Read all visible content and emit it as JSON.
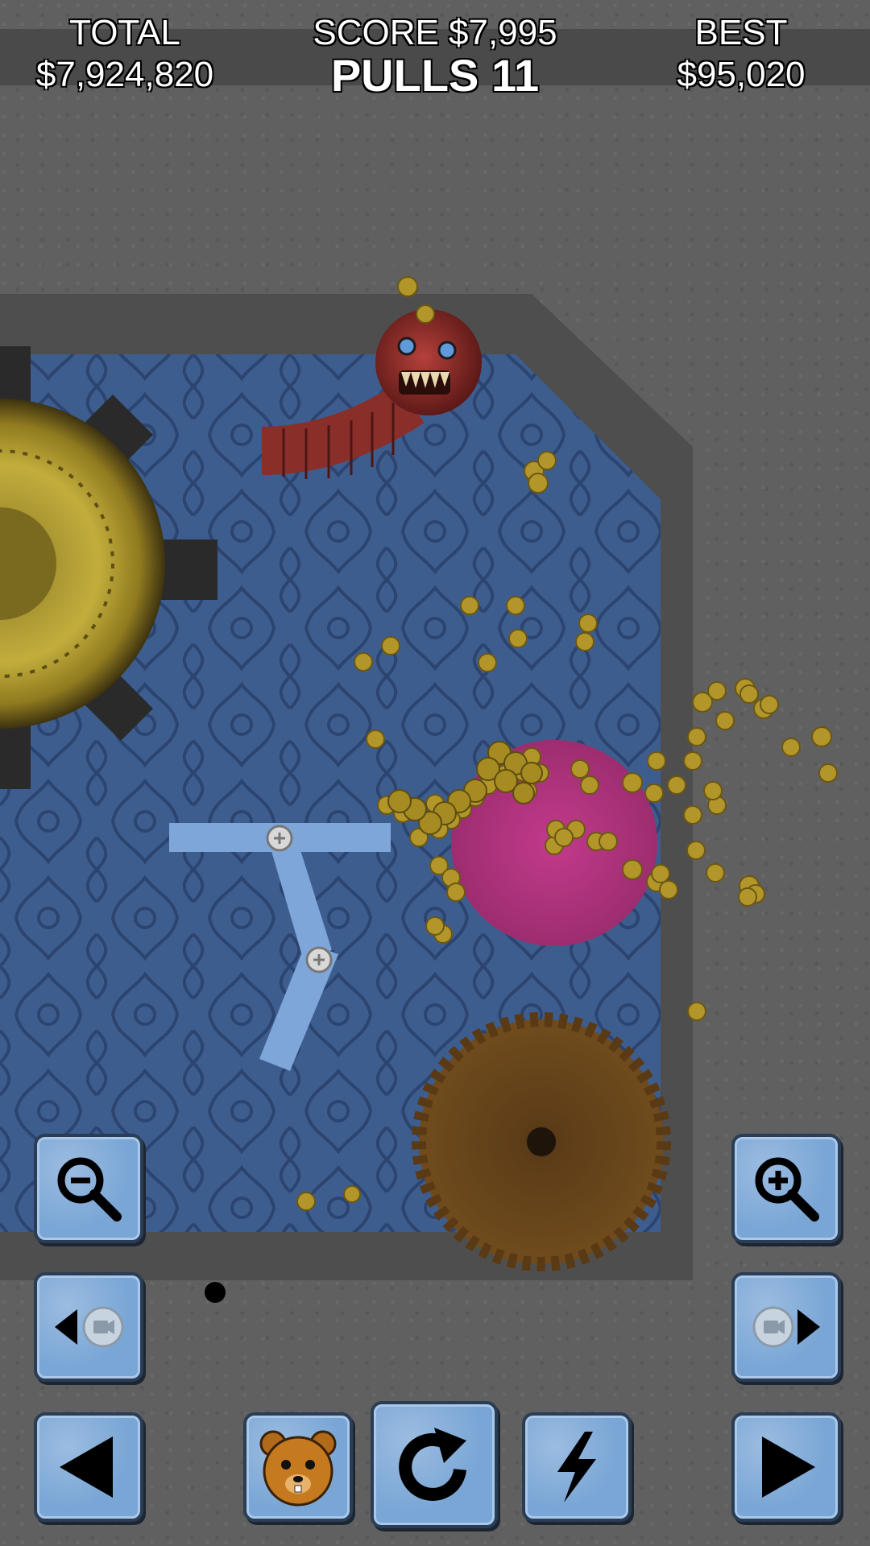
{
  "hud": {
    "total_label": "TOTAL",
    "total_value": "$7,924,820",
    "score_label": "SCORE $7,995",
    "pulls_label": "PULLS 11",
    "best_label": "BEST",
    "best_value": "$95,020"
  },
  "colors": {
    "wallpaper": "#3a5a8c",
    "pad": "#b0327a",
    "button": "#7aa6d6",
    "coin": "#b79a1f"
  },
  "controls": [
    {
      "name": "zoom-out-button",
      "icon": "zoom-out-icon"
    },
    {
      "name": "zoom-in-button",
      "icon": "zoom-in-icon"
    },
    {
      "name": "camera-left-button",
      "icon": "camera-left-icon"
    },
    {
      "name": "camera-right-button",
      "icon": "camera-right-icon"
    },
    {
      "name": "previous-button",
      "icon": "arrow-left-icon"
    },
    {
      "name": "bear-character-button",
      "icon": "bear-icon"
    },
    {
      "name": "restart-button",
      "icon": "restart-icon"
    },
    {
      "name": "power-button",
      "icon": "lightning-icon"
    },
    {
      "name": "next-button",
      "icon": "arrow-right-icon"
    }
  ]
}
